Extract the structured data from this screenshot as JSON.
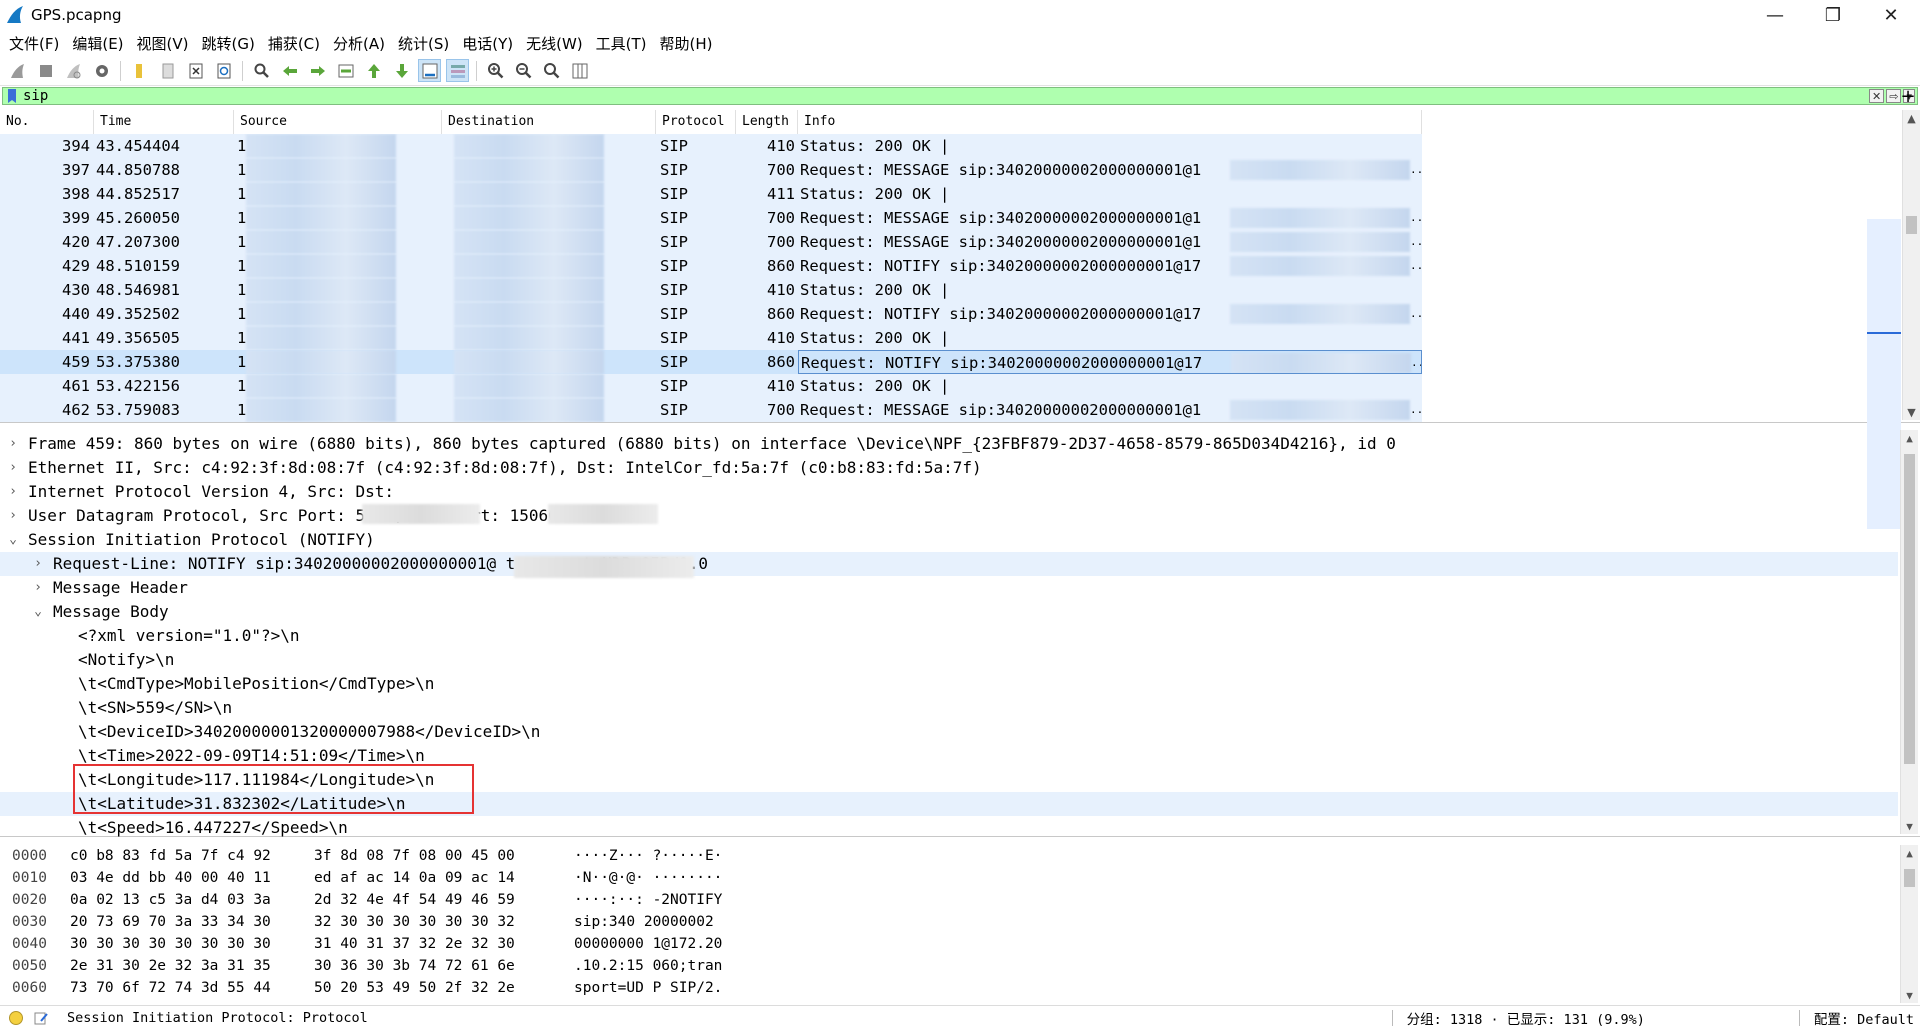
{
  "window": {
    "title": "GPS.pcapng",
    "minimize": "—",
    "restore": "❐",
    "close": "✕"
  },
  "menu": [
    "文件(F)",
    "编辑(E)",
    "视图(V)",
    "跳转(G)",
    "捕获(C)",
    "分析(A)",
    "统计(S)",
    "电话(Y)",
    "无线(W)",
    "工具(T)",
    "帮助(H)"
  ],
  "filter": {
    "value": "sip",
    "clear_icon": "✕",
    "apply_icon": "⇨",
    "dropdown": "▾",
    "add": "+"
  },
  "packet_list": {
    "columns": [
      "No.",
      "Time",
      "Source",
      "Destination",
      "Protocol",
      "Length",
      "Info"
    ],
    "rows": [
      {
        "no": "394",
        "time": "43.454404",
        "src": "1",
        "dst": "",
        "proto": "SIP",
        "len": "410",
        "info": "Status: 200 OK  |",
        "selected": false
      },
      {
        "no": "397",
        "time": "44.850788",
        "src": "1",
        "dst": "",
        "proto": "SIP",
        "len": "700",
        "info": "Request: MESSAGE sip:34020000002000000001@1",
        "selected": false
      },
      {
        "no": "398",
        "time": "44.852517",
        "src": "1",
        "dst": "",
        "proto": "SIP",
        "len": "411",
        "info": "Status: 200 OK  |",
        "selected": false
      },
      {
        "no": "399",
        "time": "45.260050",
        "src": "1",
        "dst": "",
        "proto": "SIP",
        "len": "700",
        "info": "Request: MESSAGE sip:34020000002000000001@1",
        "selected": false
      },
      {
        "no": "420",
        "time": "47.207300",
        "src": "1",
        "dst": "",
        "proto": "SIP",
        "len": "700",
        "info": "Request: MESSAGE sip:34020000002000000001@1",
        "selected": false
      },
      {
        "no": "429",
        "time": "48.510159",
        "src": "1",
        "dst": "",
        "proto": "SIP",
        "len": "860",
        "info": "Request: NOTIFY sip:34020000002000000001@17",
        "selected": false
      },
      {
        "no": "430",
        "time": "48.546981",
        "src": "1",
        "dst": "",
        "proto": "SIP",
        "len": "410",
        "info": "Status: 200 OK  |",
        "selected": false
      },
      {
        "no": "440",
        "time": "49.352502",
        "src": "1",
        "dst": "",
        "proto": "SIP",
        "len": "860",
        "info": "Request: NOTIFY sip:34020000002000000001@17",
        "selected": false
      },
      {
        "no": "441",
        "time": "49.356505",
        "src": "1",
        "dst": "",
        "proto": "SIP",
        "len": "410",
        "info": "Status: 200 OK  |",
        "selected": false
      },
      {
        "no": "459",
        "time": "53.375380",
        "src": "1",
        "dst": "",
        "proto": "SIP",
        "len": "860",
        "info": "Request: NOTIFY sip:34020000002000000001@17",
        "selected": true
      },
      {
        "no": "461",
        "time": "53.422156",
        "src": "1",
        "dst": "",
        "proto": "SIP",
        "len": "410",
        "info": "Status: 200 OK  |",
        "selected": false
      },
      {
        "no": "462",
        "time": "53.759083",
        "src": "1",
        "dst": "",
        "proto": "SIP",
        "len": "700",
        "info": "Request: MESSAGE sip:34020000002000000001@1",
        "selected": false
      }
    ],
    "trunc": ".."
  },
  "details": {
    "rows": [
      {
        "indent": 0,
        "exp": "›",
        "text": "Frame 459: 860 bytes on wire (6880 bits), 860 bytes captured (6880 bits) on interface \\Device\\NPF_{23FBF879-2D37-4658-8579-865D034D4216}, id 0",
        "hl": false
      },
      {
        "indent": 0,
        "exp": "›",
        "text": "Ethernet II, Src: c4:92:3f:8d:08:7f (c4:92:3f:8d:08:7f), Dst: IntelCor_fd:5a:7f (c0:b8:83:fd:5a:7f)",
        "hl": false
      },
      {
        "indent": 0,
        "exp": "›",
        "text": "Internet Protocol Version 4, Src:               Dst:",
        "hl": false
      },
      {
        "indent": 0,
        "exp": "›",
        "text": "User Datagram Protocol, Src Port: 5061, Dst Port: 15060",
        "hl": false
      },
      {
        "indent": 0,
        "exp": "⌄",
        "text": "Session Initiation Protocol (NOTIFY)",
        "hl": false
      },
      {
        "indent": 1,
        "exp": "›",
        "text": "Request-Line: NOTIFY sip:34020000002000000001@                  transport=UDP SIP/2.0",
        "hl": true
      },
      {
        "indent": 1,
        "exp": "›",
        "text": "Message Header",
        "hl": false
      },
      {
        "indent": 1,
        "exp": "⌄",
        "text": "Message Body",
        "hl": false
      },
      {
        "indent": 2,
        "exp": "",
        "text": "<?xml version=\"1.0\"?>\\n",
        "hl": false
      },
      {
        "indent": 2,
        "exp": "",
        "text": "<Notify>\\n",
        "hl": false
      },
      {
        "indent": 2,
        "exp": "",
        "text": "\\t<CmdType>MobilePosition</CmdType>\\n",
        "hl": false
      },
      {
        "indent": 2,
        "exp": "",
        "text": "\\t<SN>559</SN>\\n",
        "hl": false
      },
      {
        "indent": 2,
        "exp": "",
        "text": "\\t<DeviceID>34020000001320000007988</DeviceID>\\n",
        "hl": false
      },
      {
        "indent": 2,
        "exp": "",
        "text": "\\t<Time>2022-09-09T14:51:09</Time>\\n",
        "hl": false
      },
      {
        "indent": 2,
        "exp": "",
        "text": "\\t<Longitude>117.111984</Longitude>\\n",
        "hl": false
      },
      {
        "indent": 2,
        "exp": "",
        "text": "\\t<Latitude>31.832302</Latitude>\\n",
        "hl": true
      },
      {
        "indent": 2,
        "exp": "",
        "text": "\\t<Speed>16.447227</Speed>\\n",
        "hl": false
      }
    ]
  },
  "bytes": [
    {
      "off": "0000",
      "h1": "c0 b8 83 fd 5a 7f c4 92",
      "h2": "3f 8d 08 7f 08 00 45 00",
      "asc": "····Z···  ?·····E·"
    },
    {
      "off": "0010",
      "h1": "03 4e dd bb 40 00 40 11",
      "h2": "ed af ac 14 0a 09 ac 14",
      "asc": "·N··@·@·  ········"
    },
    {
      "off": "0020",
      "h1": "0a 02 13 c5 3a d4 03 3a",
      "h2": "2d 32 4e 4f 54 49 46 59",
      "asc": "····:··:  -2NOTIFY"
    },
    {
      "off": "0030",
      "h1": "20 73 69 70 3a 33 34 30",
      "h2": "32 30 30 30 30 30 30 32",
      "asc": " sip:340  20000002"
    },
    {
      "off": "0040",
      "h1": "30 30 30 30 30 30 30 30",
      "h2": "31 40 31 37 32 2e 32 30",
      "asc": "00000000  1@172.20"
    },
    {
      "off": "0050",
      "h1": "2e 31 30 2e 32 3a 31 35",
      "h2": "30 36 30 3b 74 72 61 6e",
      "asc": ".10.2:15  060;tran"
    },
    {
      "off": "0060",
      "h1": "73 70 6f 72 74 3d 55 44",
      "h2": "50 20 53 49 50 2f 32 2e",
      "asc": "sport=UD  P SIP/2."
    }
  ],
  "status": {
    "text": "Session Initiation Protocol: Protocol",
    "packets": "分组: 1318 · 已显示: 131 (9.9%)",
    "profile": "配置: Default"
  },
  "colors": {
    "accent": "#cde4fb",
    "filter_ok": "#afffaf",
    "row_bg": "#e7f1fd",
    "highlight_box": "#e53333"
  }
}
